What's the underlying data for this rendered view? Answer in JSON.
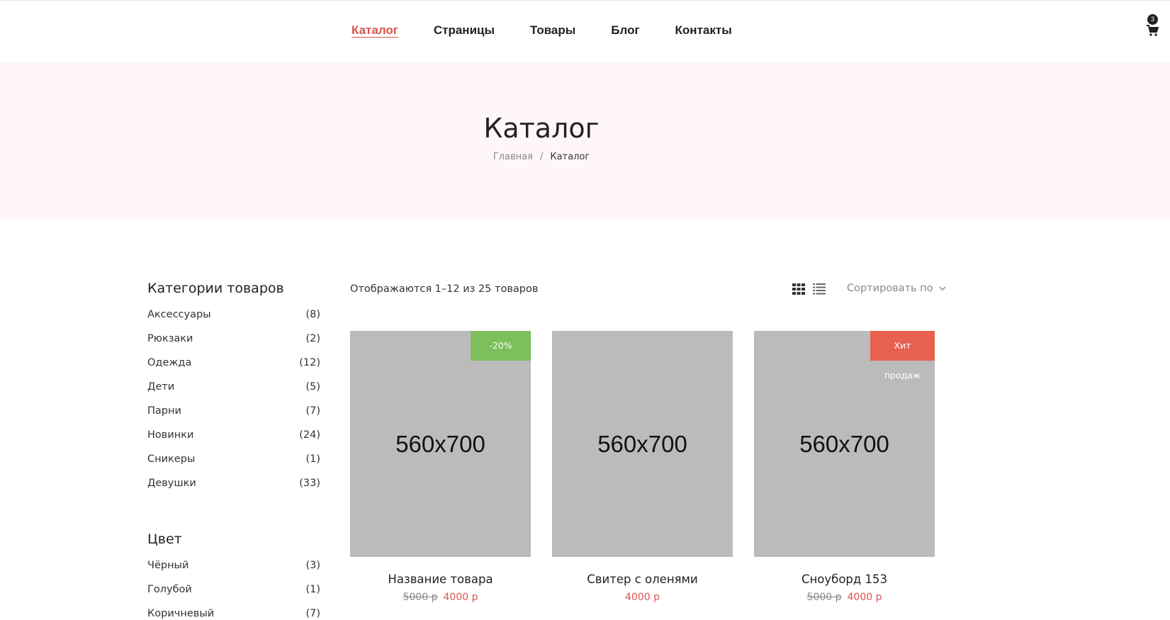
{
  "nav": {
    "items": [
      "Каталог",
      "Страницы",
      "Товары",
      "Блог",
      "Контакты"
    ],
    "active_index": 0
  },
  "cart": {
    "icon": "cart-icon",
    "count": "3"
  },
  "hero": {
    "title": "Каталог",
    "breadcrumb": {
      "home": "Главная",
      "separator": "/",
      "current": "Каталог"
    }
  },
  "sidebar": {
    "categories": {
      "title": "Категории товаров",
      "items": [
        {
          "label": "Аксессуары",
          "count": "(8)"
        },
        {
          "label": "Рюкзаки",
          "count": "(2)"
        },
        {
          "label": "Одежда",
          "count": "(12)"
        },
        {
          "label": "Дети",
          "count": "(5)"
        },
        {
          "label": "Парни",
          "count": "(7)"
        },
        {
          "label": "Новинки",
          "count": "(24)"
        },
        {
          "label": "Сникеры",
          "count": "(1)"
        },
        {
          "label": "Девушки",
          "count": "(33)"
        }
      ]
    },
    "colors": {
      "title": "Цвет",
      "items": [
        {
          "label": "Чёрный",
          "count": "(3)"
        },
        {
          "label": "Голубой",
          "count": "(1)"
        },
        {
          "label": "Коричневый",
          "count": "(7)"
        }
      ]
    }
  },
  "toolbar": {
    "result_count": "Отображаются 1–12 из 25 товаров",
    "sort_label": "Сортировать по",
    "grid_icon": "grid-view-icon",
    "list_icon": "list-view-icon"
  },
  "products": [
    {
      "image_text": "560x700",
      "badge": "-20%",
      "badge_color": "#7cbf5b",
      "name": "Название товара",
      "old_price": "5000 р",
      "price": "4000 р"
    },
    {
      "image_text": "560x700",
      "badge": "",
      "badge_color": "",
      "name": "Свитер с оленями",
      "old_price": "",
      "price": "4000 р"
    },
    {
      "image_text": "560x700",
      "badge": "Хит продаж",
      "badge_color": "#e8604f",
      "name": "Сноуборд 153",
      "old_price": "5000 р",
      "price": "4000 р"
    }
  ],
  "colors": {
    "accent": "#d9534f",
    "hero_bg": "#fff7f7",
    "placeholder": "#bbbbbb"
  }
}
